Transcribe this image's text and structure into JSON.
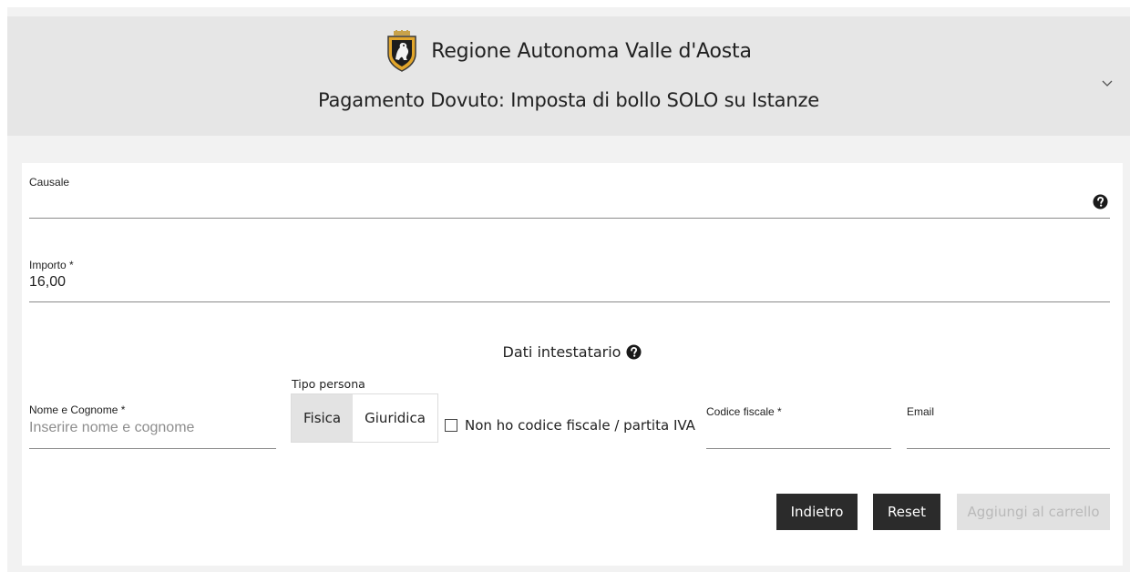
{
  "header": {
    "brand_name": "Regione Autonoma Valle d'Aosta",
    "page_title": "Pagamento Dovuto: Imposta di bollo SOLO su Istanze",
    "crest_icon": "region-crest-icon",
    "toggle_icon": "chevron-down-icon"
  },
  "form": {
    "causale": {
      "label": "Causale",
      "value": ""
    },
    "importo": {
      "label": "Importo *",
      "value": "16,00"
    },
    "section_title": "Dati intestatario",
    "nome": {
      "label": "Nome e Cognome *",
      "placeholder": "Inserire nome e cognome"
    },
    "tipo_persona": {
      "label": "Tipo persona",
      "options": [
        "Fisica",
        "Giuridica"
      ],
      "selected": "Fisica"
    },
    "no_cf_checkbox": {
      "label": "Non ho codice fiscale / partita IVA",
      "checked": false
    },
    "codice_fiscale": {
      "label": "Codice fiscale *",
      "value": ""
    },
    "email": {
      "label": "Email",
      "value": ""
    }
  },
  "actions": {
    "back": "Indietro",
    "reset": "Reset",
    "add_to_cart": "Aggiungi al carrello"
  },
  "colors": {
    "header_bg": "#e6e6e6",
    "page_bg": "#f2f2f2",
    "button_dark": "#2b2b2b",
    "button_disabled": "#e1e1e1"
  }
}
